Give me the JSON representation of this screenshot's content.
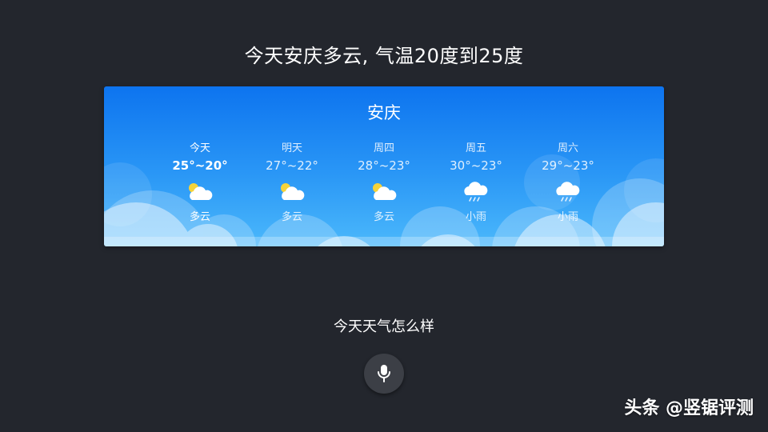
{
  "response": {
    "text": "今天安庆多云, 气温20度到25度"
  },
  "weather_card": {
    "city": "安庆",
    "forecast": [
      {
        "day": "今天",
        "temp": "25°~20°",
        "condition": "多云",
        "icon": "partly-cloudy-icon"
      },
      {
        "day": "明天",
        "temp": "27°~22°",
        "condition": "多云",
        "icon": "partly-cloudy-icon"
      },
      {
        "day": "周四",
        "temp": "28°~23°",
        "condition": "多云",
        "icon": "partly-cloudy-icon"
      },
      {
        "day": "周五",
        "temp": "30°~23°",
        "condition": "小雨",
        "icon": "light-rain-icon"
      },
      {
        "day": "周六",
        "temp": "29°~23°",
        "condition": "小雨",
        "icon": "light-rain-icon"
      }
    ]
  },
  "query": {
    "text": "今天天气怎么样"
  },
  "mic": {
    "icon": "microphone-icon"
  },
  "watermark": {
    "text": "头条 @竖锯评测"
  },
  "colors": {
    "background": "#23262d",
    "card_top": "#0d74ef",
    "card_bottom": "#4bb8fb",
    "sun": "#f5d33a"
  }
}
